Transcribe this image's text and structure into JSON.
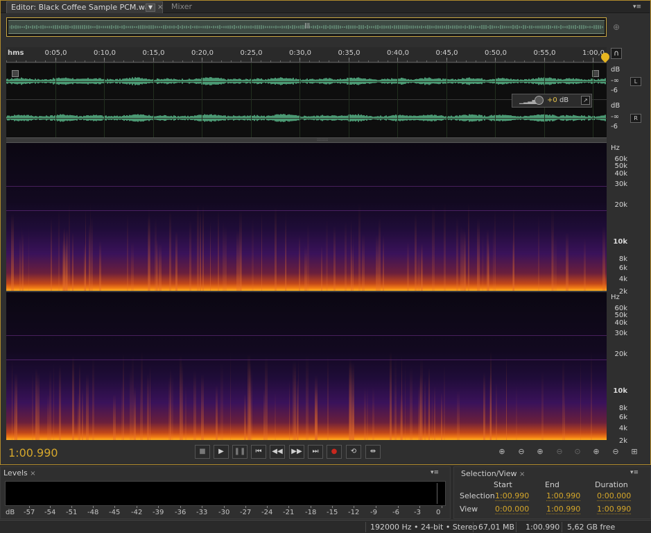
{
  "tabs": {
    "editor_label": "Editor: Black Coffee Sample PCM.wav",
    "dropdown_icon": "chevron-down-icon",
    "mixer_label": "Mixer",
    "close_glyph": "×",
    "menu_glyph": "▾≡"
  },
  "overview": {
    "handle_glyph": "|||"
  },
  "ruler": {
    "unit": "hms",
    "ticks": [
      "0:05,0",
      "0:10,0",
      "0:15,0",
      "0:20,0",
      "0:25,0",
      "0:30,0",
      "0:35,0",
      "0:40,0",
      "0:45,0",
      "0:50,0",
      "0:55,0",
      "1:00,0"
    ]
  },
  "channels": {
    "db_unit": "dB",
    "inf_label": "-∞",
    "minus6_label": "-6",
    "left_label": "L",
    "right_label": "R"
  },
  "hud": {
    "gain": "+0",
    "unit": "dB"
  },
  "spectral": {
    "unit": "Hz",
    "labels": [
      "60k",
      "50k",
      "40k",
      "30k",
      "20k",
      "10k",
      "8k",
      "6k",
      "4k",
      "2k"
    ]
  },
  "transport": {
    "current_time": "1:00.990",
    "buttons": [
      "stop-icon",
      "play-icon",
      "pause-icon",
      "go-to-start-icon",
      "rewind-icon",
      "fast-forward-icon",
      "go-to-end-icon",
      "record-icon",
      "loop-icon",
      "skip-selection-icon"
    ],
    "zoom_buttons": [
      "zoom-in-amplitude-icon",
      "zoom-out-amplitude-icon",
      "zoom-in-time-icon",
      "zoom-out-full-icon",
      "zoom-in-point-icon",
      "zoom-in-selection-icon",
      "zoom-out-selection-icon",
      "zoom-full-icon"
    ]
  },
  "levels": {
    "tab_label": "Levels",
    "scale": [
      "dB",
      "-57",
      "-54",
      "-51",
      "-48",
      "-45",
      "-42",
      "-39",
      "-36",
      "-33",
      "-30",
      "-27",
      "-24",
      "-21",
      "-18",
      "-15",
      "-12",
      "-9",
      "-6",
      "-3",
      "0"
    ]
  },
  "selection_view": {
    "tab_label": "Selection/View",
    "headers": {
      "start": "Start",
      "end": "End",
      "duration": "Duration"
    },
    "selection": {
      "label": "Selection",
      "start": "1:00.990",
      "end": "1:00.990",
      "duration": "0:00.000"
    },
    "view": {
      "label": "View",
      "start": "0:00.000",
      "end": "1:00.990",
      "duration": "1:00.990"
    }
  },
  "status": {
    "format": "192000 Hz • 24-bit • Stereo",
    "file_size": "67,01 MB",
    "duration": "1:00.990",
    "free_space": "5,62 GB free"
  },
  "colors": {
    "accent": "#d5a72c",
    "waveform": "#66d7a0",
    "frame": "#b08a2c"
  }
}
